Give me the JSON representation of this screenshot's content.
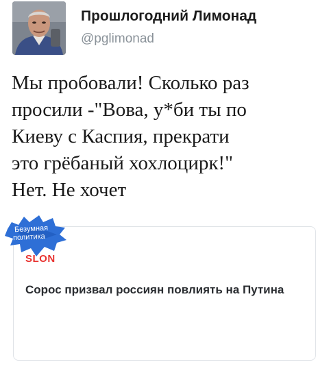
{
  "tweet": {
    "author_name": "Прошлогодний Лимонад",
    "author_handle": "@pglimonad",
    "text_lines": [
      "Мы пробовали! Сколько раз",
      "просили -\"Вова, у*би ты по",
      "Киеву с Каспия, прекрати",
      "это грёбаный хохлоцирк!\"",
      "Нет. Не хочет"
    ]
  },
  "link_card": {
    "brand": "SLON",
    "headline": "Сорос призвал россиян повлиять на Путина"
  },
  "watermark": {
    "line1": "Безумная",
    "line2": "политика"
  },
  "colors": {
    "brand_red": "#e8322f",
    "handle_gray": "#8a9299",
    "watermark_blue": "#2e6fd6"
  },
  "icons": {
    "avatar": "user-photo",
    "watermark": "paint-splash"
  }
}
